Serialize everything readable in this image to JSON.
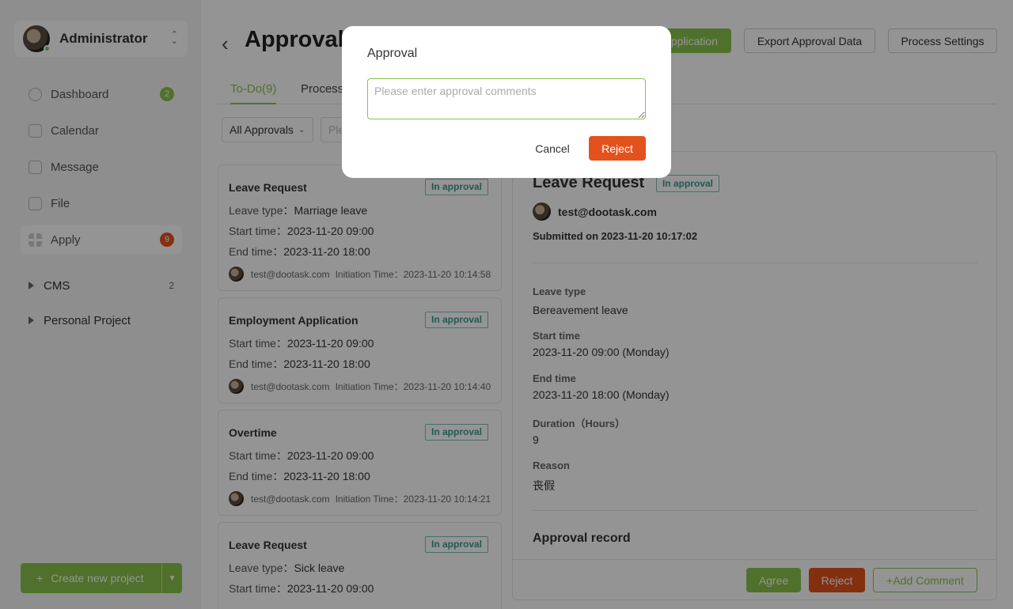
{
  "sidebar": {
    "user_name": "Administrator",
    "nav": [
      {
        "label": "Dashboard",
        "badge": "2"
      },
      {
        "label": "Calendar"
      },
      {
        "label": "Message"
      },
      {
        "label": "File"
      },
      {
        "label": "Apply",
        "badge": "9"
      }
    ],
    "projects": [
      {
        "label": "CMS",
        "count": "2"
      },
      {
        "label": "Personal Project"
      }
    ],
    "create_label": "Create new project"
  },
  "header": {
    "title": "Approval",
    "apply_label": "pplication",
    "export_label": "Export Approval Data",
    "settings_label": "Process Settings"
  },
  "tabs": [
    "To-Do(9)",
    "Process"
  ],
  "filter": {
    "select": "All Approvals",
    "input_placeholder": "Ple"
  },
  "cards": [
    {
      "title": "Leave Request",
      "status": "In approval",
      "rows": [
        {
          "k": "Leave type：",
          "v": "Marriage leave"
        },
        {
          "k": "Start time：",
          "v": "2023-11-20 09:00"
        },
        {
          "k": "End time：",
          "v": "2023-11-20 18:00"
        }
      ],
      "user": "test@dootask.com",
      "initiation": "Initiation Time：2023-11-20 10:14:58"
    },
    {
      "title": "Employment Application",
      "status": "In approval",
      "rows": [
        {
          "k": "Start time：",
          "v": "2023-11-20 09:00"
        },
        {
          "k": "End time：",
          "v": "2023-11-20 18:00"
        }
      ],
      "user": "test@dootask.com",
      "initiation": "Initiation Time：2023-11-20 10:14:40"
    },
    {
      "title": "Overtime",
      "status": "In approval",
      "rows": [
        {
          "k": "Start time：",
          "v": "2023-11-20 09:00"
        },
        {
          "k": "End time：",
          "v": "2023-11-20 18:00"
        }
      ],
      "user": "test@dootask.com",
      "initiation": "Initiation Time：2023-11-20 10:14:21"
    },
    {
      "title": "Leave Request",
      "status": "In approval",
      "rows": [
        {
          "k": "Leave type：",
          "v": "Sick leave"
        },
        {
          "k": "Start time：",
          "v": "2023-11-20 09:00"
        }
      ]
    }
  ],
  "detail": {
    "title": "Leave Request",
    "status": "In approval",
    "user": "test@dootask.com",
    "submitted": "Submitted on 2023-11-20 10:17:02",
    "fields": [
      {
        "label": "Leave type",
        "value": "Bereavement leave"
      },
      {
        "label": "Start time",
        "value": "2023-11-20 09:00 (Monday)"
      },
      {
        "label": "End time",
        "value": "2023-11-20 18:00 (Monday)"
      },
      {
        "label": "Duration（Hours）",
        "value": "9"
      },
      {
        "label": "Reason",
        "value": "丧假"
      }
    ],
    "record_title": "Approval record",
    "agree_label": "Agree",
    "reject_label": "Reject",
    "comment_label": "+Add Comment"
  },
  "modal": {
    "title": "Approval",
    "placeholder": "Please enter approval comments",
    "cancel_label": "Cancel",
    "reject_label": "Reject"
  },
  "colors": {
    "accent": "#8bc34a",
    "danger": "#e3521d",
    "tag": "#3a9c8a"
  }
}
